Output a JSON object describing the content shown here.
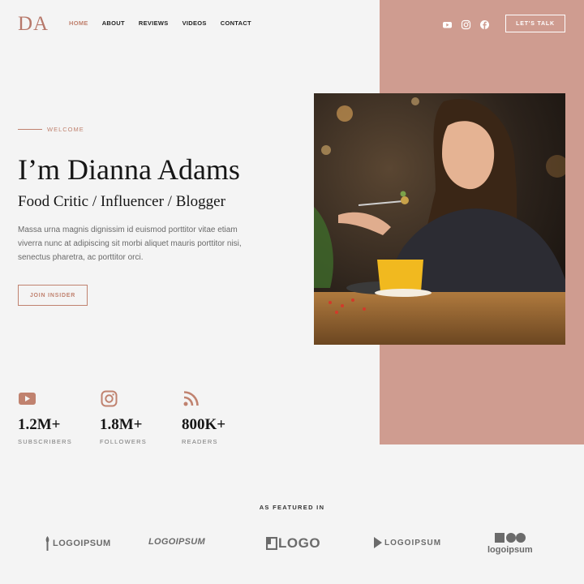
{
  "brand": {
    "logo": "DA",
    "accent_color": "#c0826f",
    "panel_color": "#cf9c90"
  },
  "nav": [
    {
      "label": "HOME",
      "active": true
    },
    {
      "label": "ABOUT"
    },
    {
      "label": "REVIEWS"
    },
    {
      "label": "VIDEOS"
    },
    {
      "label": "CONTACT"
    }
  ],
  "socials": [
    "youtube-icon",
    "instagram-icon",
    "facebook-icon"
  ],
  "header_cta": "LET'S TALK",
  "hero": {
    "eyebrow": "WELCOME",
    "title": "I’m Dianna Adams",
    "subtitle": "Food Critic / Influencer / Blogger",
    "description": "Massa urna magnis dignissim id euismod porttitor vitae etiam viverra nunc at adipiscing sit morbi aliquet mauris porttitor nisi, senectus pharetra, ac porttitor orci.",
    "cta": "JOIN INSIDER"
  },
  "stats": [
    {
      "icon": "youtube-icon",
      "value": "1.2M+",
      "label": "SUBSCRIBERS"
    },
    {
      "icon": "instagram-icon",
      "value": "1.8M+",
      "label": "FOLLOWERS"
    },
    {
      "icon": "rss-icon",
      "value": "800K+",
      "label": "READERS"
    }
  ],
  "featured": {
    "heading": "AS FEATURED IN",
    "logos": [
      "LOGOIPSUM",
      "LOGOIPSUM",
      "LOGO",
      "LOGOIPSUM",
      "logoipsum"
    ]
  }
}
